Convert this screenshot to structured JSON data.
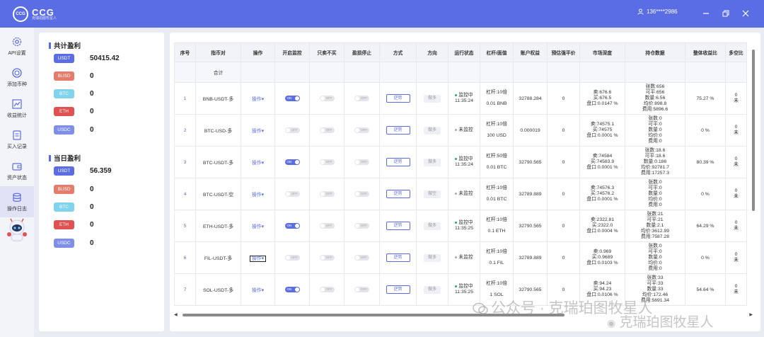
{
  "app": {
    "logo_mark": "CCG",
    "logo_title": "CCG",
    "logo_subtitle": "克瑞珀图牧星人",
    "user": "136****2986"
  },
  "sidebar": {
    "items": [
      {
        "label": "API设置",
        "icon": "gear-icon"
      },
      {
        "label": "添加币种",
        "icon": "add-coin-icon"
      },
      {
        "label": "收益统计",
        "icon": "chart-icon"
      },
      {
        "label": "买入记录",
        "icon": "record-icon"
      },
      {
        "label": "资产状态",
        "icon": "wallet-icon"
      },
      {
        "label": "操作日志",
        "icon": "log-icon"
      }
    ]
  },
  "profit": {
    "total_title": "共计盈利",
    "daily_title": "当日盈利",
    "total": [
      {
        "coin": "USDT",
        "value": "50415.42",
        "color": "#5b6de4"
      },
      {
        "coin": "BUSD",
        "value": "0",
        "color": "#e57c6a"
      },
      {
        "coin": "BTC",
        "value": "0",
        "color": "#7fd3ea"
      },
      {
        "coin": "ETH",
        "value": "0",
        "color": "#e05252"
      },
      {
        "coin": "USDC",
        "value": "0",
        "color": "#7f8fe8"
      }
    ],
    "daily": [
      {
        "coin": "USDT",
        "value": "56.359",
        "color": "#5b6de4"
      },
      {
        "coin": "BUSD",
        "value": "0",
        "color": "#e57c6a"
      },
      {
        "coin": "BTC",
        "value": "0",
        "color": "#7fd3ea"
      },
      {
        "coin": "ETH",
        "value": "0",
        "color": "#e05252"
      },
      {
        "coin": "USDC",
        "value": "0",
        "color": "#7f8fe8"
      }
    ]
  },
  "table": {
    "headers": [
      "序号",
      "指币对",
      "操作",
      "开启监控",
      "只卖不买",
      "盈损停止",
      "方式",
      "方向",
      "运行状态",
      "杠杆/面值",
      "账户权益",
      "预估强平价",
      "市场深度",
      "持仓数据",
      "整体收益比",
      "多空比"
    ],
    "sum_label": "合计",
    "on_text": "ON",
    "off_text": "OFF",
    "rows": [
      {
        "idx": "1",
        "pair": "BNB-USDT-多",
        "op": "操作▾",
        "op_boxed": false,
        "monitor": true,
        "method": "逆势",
        "direction": "做多",
        "status": "监控中",
        "status_time": "11:35:24",
        "running": true,
        "lev": "杠杆:10倍",
        "face": "0.01 BNB",
        "equity": "32788.284",
        "liq": "0",
        "d_sell": "卖:676.6",
        "d_buy": "买:676.5",
        "d_spread": "盘口:0.0147 %",
        "pos": [
          "张数:656",
          "可平:656",
          "数量:6.56",
          "均价:898.8",
          "费用:5896.6"
        ],
        "ratio": "75.27 %",
        "ls": [
          "0",
          "未"
        ]
      },
      {
        "idx": "2",
        "pair": "BTC-USD-多",
        "op": "操作▾",
        "op_boxed": false,
        "monitor": false,
        "method": "逆势",
        "direction": "做多",
        "status": "未监控",
        "status_time": "",
        "running": false,
        "lev": "杠杆:10倍",
        "face": "100 USD",
        "equity": "0.000019",
        "liq": "0",
        "d_sell": "卖:74575.1",
        "d_buy": "买:74575",
        "d_spread": "盘口:0.0001 %",
        "pos": [
          "张数:0",
          "可平:0",
          "数量:0",
          "均价:0",
          "费用:0"
        ],
        "ratio": "0 %",
        "ls": [
          "0",
          "未"
        ]
      },
      {
        "idx": "3",
        "pair": "BTC-USDT-多",
        "op": "操作▾",
        "op_boxed": false,
        "monitor": true,
        "method": "逆势",
        "direction": "做多",
        "status": "监控中",
        "status_time": "11:35:24",
        "running": true,
        "lev": "杠杆:50倍",
        "face": "0.01 BTC",
        "equity": "32790.565",
        "liq": "0",
        "d_sell": "卖:74584",
        "d_buy": "买:74583.9",
        "d_spread": "盘口:0.0001 %",
        "pos": [
          "张数:18.6",
          "可平:18.6",
          "数量:0.186",
          "均价:92781.7",
          "费用:17257.3"
        ],
        "ratio": "80.39 %",
        "ls": [
          "0",
          "未"
        ]
      },
      {
        "idx": "4",
        "pair": "BTC-USDT-空",
        "op": "操作▾",
        "op_boxed": false,
        "monitor": false,
        "method": "逆势",
        "direction": "做空",
        "status": "未监控",
        "status_time": "",
        "running": false,
        "lev": "杠杆:10倍",
        "face": "0.01 BTC",
        "equity": "32789.889",
        "liq": "0",
        "d_sell": "卖:74576.3",
        "d_buy": "买:74576.2",
        "d_spread": "盘口:0.0001 %",
        "pos": [
          "张数:0",
          "可平:0",
          "数量:0",
          "均价:0",
          "费用:0"
        ],
        "ratio": "0 %",
        "ls": [
          "0",
          "未"
        ]
      },
      {
        "idx": "5",
        "pair": "ETH-USDT-多",
        "op": "操作▾",
        "op_boxed": false,
        "monitor": true,
        "method": "逆势",
        "direction": "做多",
        "status": "监控中",
        "status_time": "11:35:25",
        "running": true,
        "lev": "杠杆:10倍",
        "face": "0.1 ETH",
        "equity": "32790.565",
        "liq": "0",
        "d_sell": "卖:2322.81",
        "d_buy": "买:2322.0",
        "d_spread": "盘口:0.0004 %",
        "pos": [
          "张数:21",
          "可平:21",
          "数量:2.1",
          "均价:3612.99",
          "费用:7587.28"
        ],
        "ratio": "64.29 %",
        "ls": [
          "0",
          "未"
        ]
      },
      {
        "idx": "6",
        "pair": "FIL-USDT-多",
        "op": "操作▾",
        "op_boxed": true,
        "monitor": false,
        "method": "逆势",
        "direction": "做多",
        "status": "未监控",
        "status_time": "",
        "running": false,
        "lev": "杠杆:10倍",
        "face": "0.1 FIL",
        "equity": "32789.889",
        "liq": "0",
        "d_sell": "卖:0.969",
        "d_buy": "买:0.9689",
        "d_spread": "盘口:0.0103 %",
        "pos": [
          "张数:0",
          "可平:0",
          "数量:0",
          "均价:0",
          "费用:0"
        ],
        "ratio": "0 %",
        "ls": [
          "0",
          "未"
        ]
      },
      {
        "idx": "7",
        "pair": "SOL-USDT-多",
        "op": "操作▾",
        "op_boxed": false,
        "monitor": true,
        "method": "逆势",
        "direction": "做多",
        "status": "监控中",
        "status_time": "11:35:25",
        "running": true,
        "lev": "杠杆:10倍",
        "face": "1 SOL",
        "equity": "32790.565",
        "liq": "0",
        "d_sell": "卖:94.24",
        "d_buy": "买:94.23",
        "d_spread": "盘口:0.0106 %",
        "pos": [
          "张数:33",
          "可平:33",
          "数量:33",
          "均价:172.46",
          "费用:5691.34"
        ],
        "ratio": "54.64 %",
        "ls": [
          "0",
          "未"
        ]
      }
    ]
  },
  "watermark": {
    "text1": "公众号 · 克瑞珀图牧星人",
    "text2": "克瑞珀图牧星人"
  }
}
